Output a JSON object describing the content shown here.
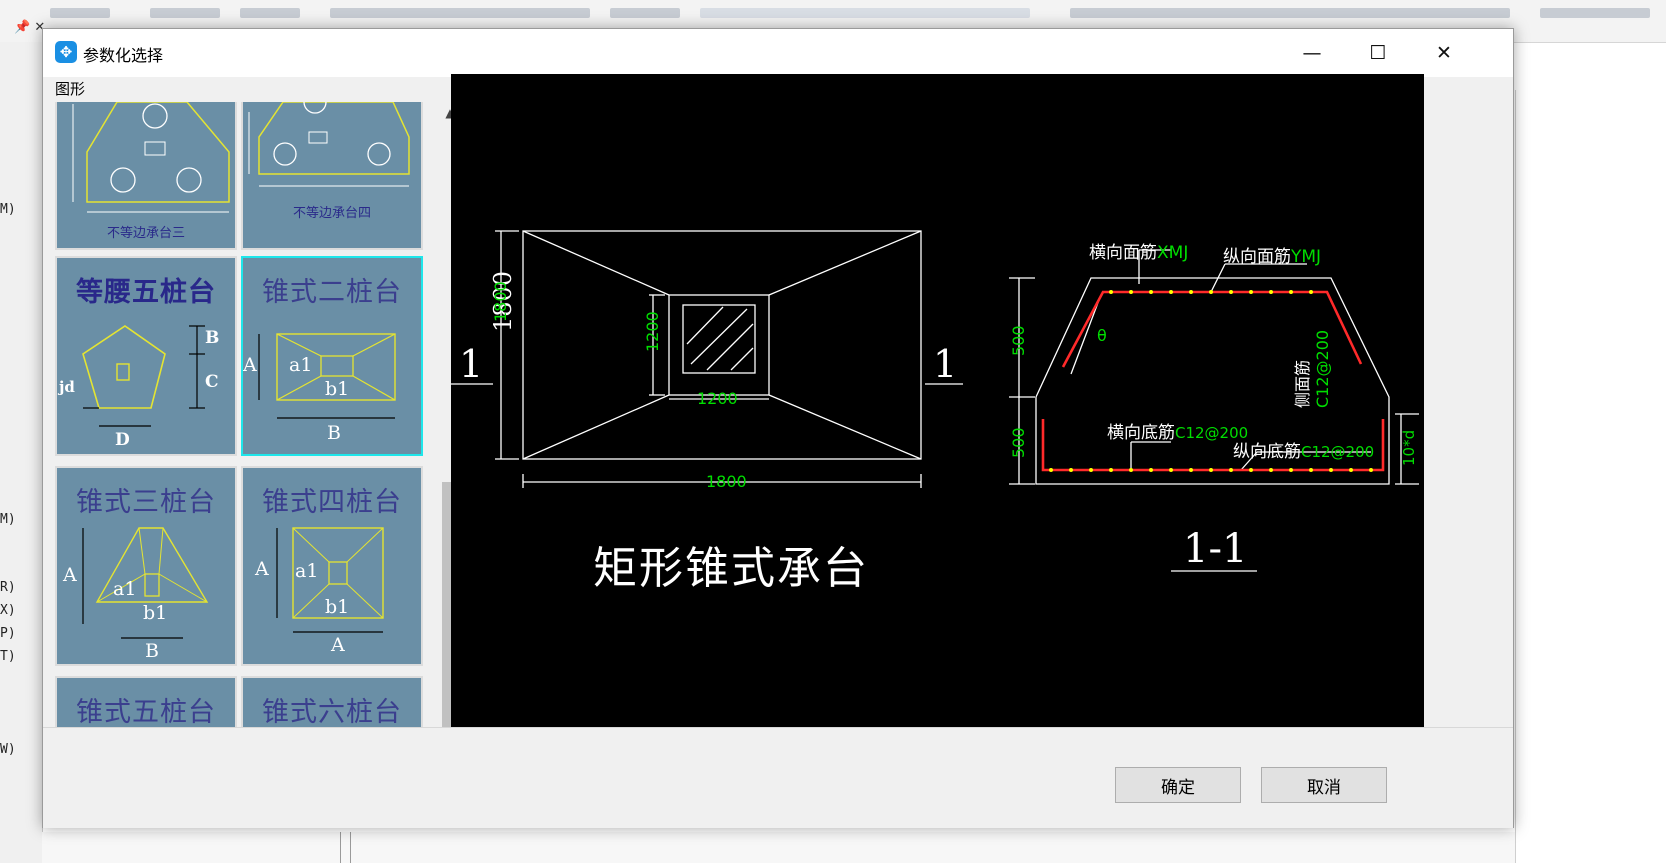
{
  "background": {
    "pin_glyphs": "📌 ✕",
    "left_keys": [
      "M)",
      "M)",
      "R)",
      "X)",
      "P)",
      "T)",
      "W)"
    ]
  },
  "dialog": {
    "title": "参数化选择",
    "minimize_glyph": "—",
    "maximize_glyph": "☐",
    "close_glyph": "✕",
    "panel_label": "图形",
    "ok_label": "确定",
    "cancel_label": "取消"
  },
  "shapes": [
    {
      "label": "不等边承台三"
    },
    {
      "label": "不等边承台四"
    },
    {
      "label": "等腰五桩台",
      "dims": [
        "B",
        "C",
        "D",
        "jd"
      ]
    },
    {
      "label": "锥式二桩台",
      "selected": true,
      "dims": [
        "A",
        "a1",
        "b1",
        "B"
      ]
    },
    {
      "label": "锥式三桩台",
      "dims": [
        "A",
        "a1",
        "b1",
        "B"
      ]
    },
    {
      "label": "锥式四桩台",
      "dims": [
        "A",
        "a1",
        "b1",
        "A"
      ]
    },
    {
      "label": "锥式五桩台"
    },
    {
      "label": "锥式六桩台"
    }
  ],
  "preview": {
    "plan": {
      "title": "矩形锥式承台",
      "dim_outer_h": "1800",
      "dim_outer_w": "1800",
      "dim_inner_h": "1200",
      "dim_inner_w": "1200",
      "section_mark": "1"
    },
    "section": {
      "title": "1-1",
      "top_rebar_x_label": "横向面筋",
      "top_rebar_x_value": "XMJ",
      "top_rebar_y_label": "纵向面筋",
      "top_rebar_y_value": "YMJ",
      "side_rebar_label": "侧面筋",
      "side_rebar_value": "C12@200",
      "bottom_rebar_x_label": "横向底筋",
      "bottom_rebar_x_value": "C12@200",
      "bottom_rebar_y_label": "纵向底筋",
      "bottom_rebar_y_value": "C12@200",
      "dim_upper": "500",
      "dim_lower": "500",
      "dim_right": "10*d",
      "angle_label": "θ"
    },
    "colors": {
      "line": "#ffffff",
      "dim_text": "#00dd00",
      "rebar": "#ff2a2a",
      "rebar_dot": "#ffff00"
    }
  }
}
